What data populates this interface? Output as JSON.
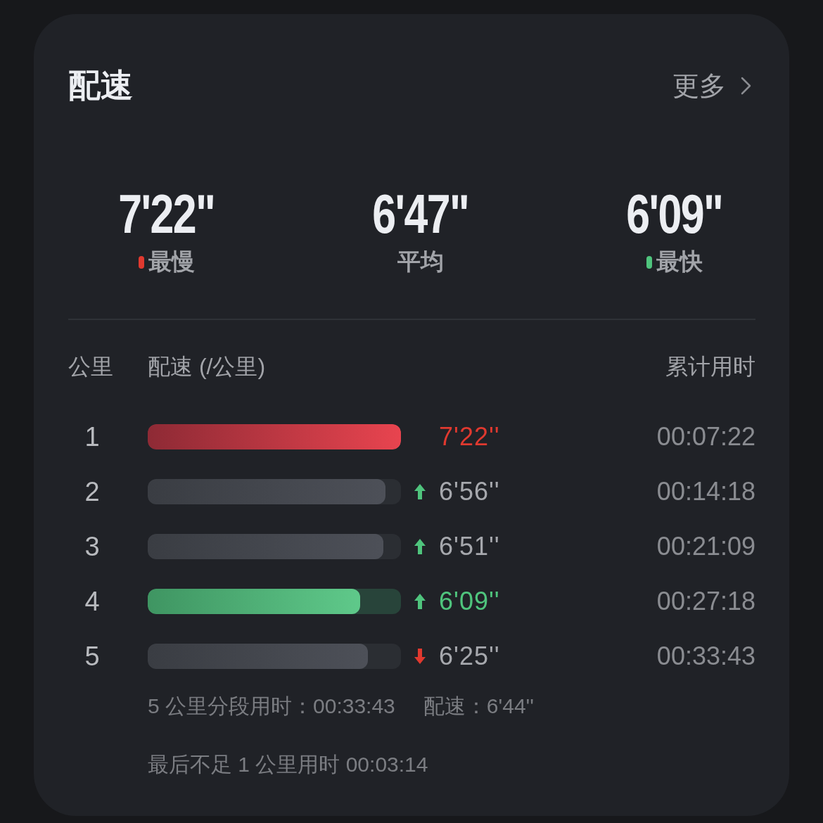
{
  "card": {
    "title": "配速",
    "more_link": "更多"
  },
  "summary": [
    {
      "value": "7'22\"",
      "label": "最慢",
      "color": "#e0392f"
    },
    {
      "value": "6'47\"",
      "label": "平均"
    },
    {
      "value": "6'09\"",
      "label": "最快",
      "color": "#4fc47d"
    }
  ],
  "columns": [
    "公里",
    "配速 (/公里)",
    "累计用时"
  ],
  "rows": [
    {
      "km": "1",
      "kind": "slowest",
      "level": 1.0,
      "pace": "7'22''",
      "total": "00:07:22"
    },
    {
      "km": "2",
      "kind": "normal",
      "level": 0.94,
      "faster": true,
      "pace": "6'56''",
      "total": "00:14:18"
    },
    {
      "km": "3",
      "kind": "normal",
      "level": 0.93,
      "faster": true,
      "pace": "6'51''",
      "total": "00:21:09"
    },
    {
      "km": "4",
      "kind": "fastest",
      "level": 0.84,
      "faster": true,
      "pace": "6'09''",
      "total": "00:27:18"
    },
    {
      "km": "5",
      "kind": "normal",
      "level": 0.87,
      "faster": false,
      "pace": "6'25''",
      "total": "00:33:43"
    }
  ],
  "footer": {
    "split_time": "5 公里分段用时：00:33:43",
    "split_pace": "配速：6'44''",
    "remainder": "最后不足 1 公里用时 00:03:14"
  }
}
